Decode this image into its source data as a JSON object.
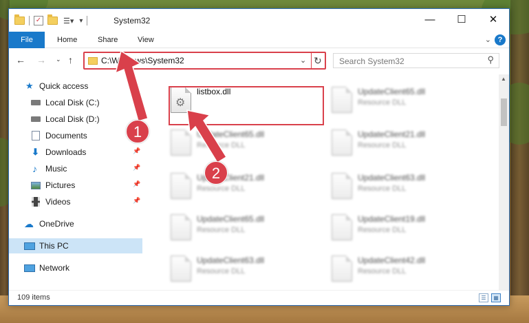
{
  "window": {
    "title": "System32",
    "controls": {
      "minimize": "—",
      "maximize": "☐",
      "close": "✕"
    }
  },
  "ribbon": {
    "tabs": [
      "File",
      "Home",
      "Share",
      "View"
    ],
    "help": "?"
  },
  "navbar": {
    "address": "C:\\Windows\\System32",
    "search_placeholder": "Search System32"
  },
  "sidebar": {
    "items": [
      {
        "label": "Quick access",
        "icon": "star-icon"
      },
      {
        "label": "Local Disk (C:)",
        "icon": "drive-icon",
        "pinned": true
      },
      {
        "label": "Local Disk (D:)",
        "icon": "drive-icon"
      },
      {
        "label": "Documents",
        "icon": "documents-icon",
        "pinned": true
      },
      {
        "label": "Downloads",
        "icon": "download-arrow-icon",
        "pinned": true
      },
      {
        "label": "Music",
        "icon": "music-note-icon",
        "pinned": true
      },
      {
        "label": "Pictures",
        "icon": "pictures-icon",
        "pinned": true
      },
      {
        "label": "Videos",
        "icon": "film-icon",
        "pinned": true
      },
      {
        "label": "OneDrive",
        "icon": "cloud-icon"
      },
      {
        "label": "This PC",
        "icon": "monitor-icon",
        "selected": true
      },
      {
        "label": "Network",
        "icon": "network-icon"
      }
    ]
  },
  "files": [
    {
      "name": "listbox.dll",
      "type": ""
    },
    {
      "name": "UpdateClient65.dll",
      "type": "Resource DLL"
    },
    {
      "name": "UpdateClient65.dll",
      "type": "Resource DLL"
    },
    {
      "name": "UpdateClient21.dll",
      "type": "Resource DLL"
    },
    {
      "name": "UpdateClient21.dll",
      "type": "Resource DLL"
    },
    {
      "name": "UpdateClient63.dll",
      "type": "Resource DLL"
    },
    {
      "name": "UpdateClient65.dll",
      "type": "Resource DLL"
    },
    {
      "name": "UpdateClient19.dll",
      "type": "Resource DLL"
    },
    {
      "name": "UpdateClient63.dll",
      "type": "Resource DLL"
    },
    {
      "name": "UpdateClient42.dll",
      "type": "Resource DLL"
    }
  ],
  "status": {
    "item_count": "109 items"
  },
  "annotations": {
    "step1": "1",
    "step2": "2",
    "color": "#d9404b"
  }
}
